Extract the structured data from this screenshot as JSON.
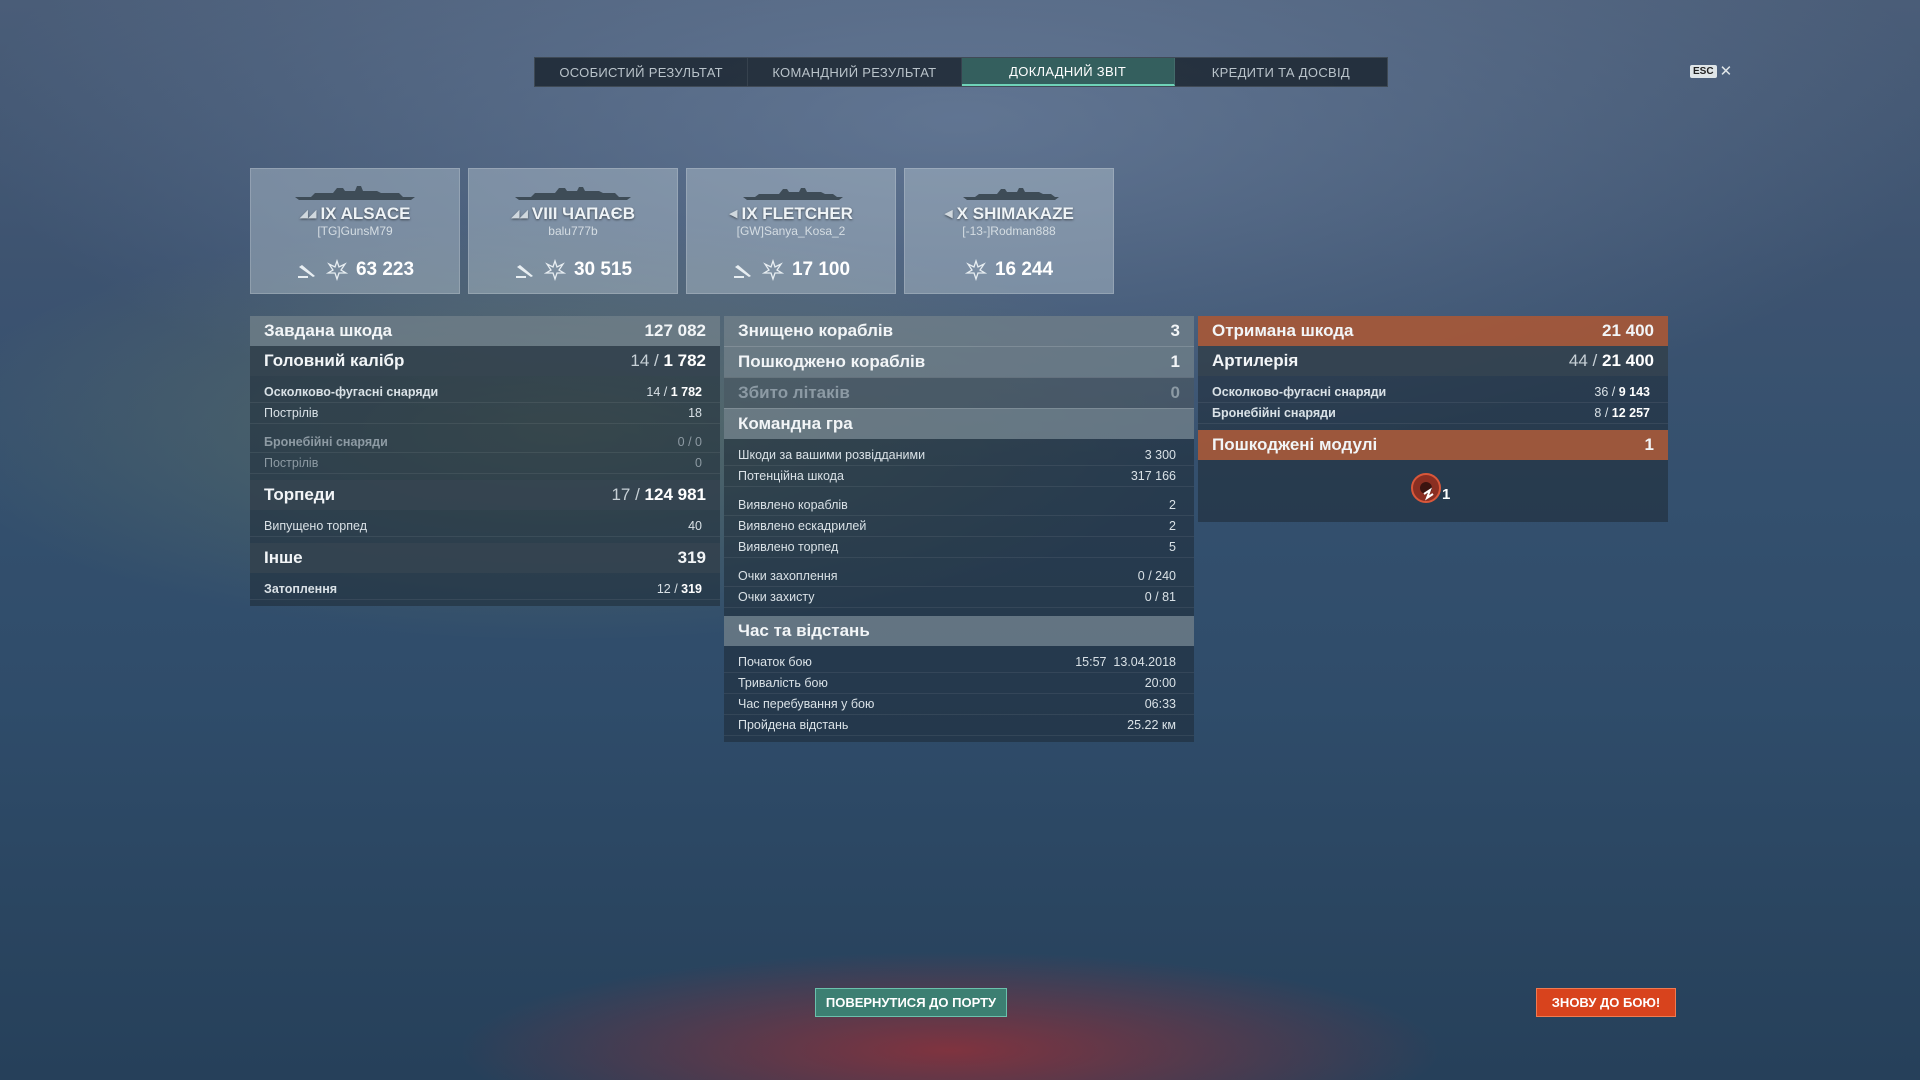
{
  "tabs": [
    "ОСОБИСТИЙ РЕЗУЛЬТАТ",
    "КОМАНДНИЙ РЕЗУЛЬТАТ",
    "ДОКЛАДНИЙ ЗВІТ",
    "КРЕДИТИ ТА ДОСВІД"
  ],
  "active_tab": "ДОКЛАДНИЙ ЗВІТ",
  "esc": {
    "key": "ESC",
    "close": "✕"
  },
  "ships": [
    {
      "tier_name": "IX ALSACE",
      "player": "[TG]GunsM79",
      "damage": "63 223"
    },
    {
      "tier_name": "VIII ЧАПАЄВ",
      "player": "balu777b",
      "damage": "30 515"
    },
    {
      "tier_name": "IX FLETCHER",
      "player": "[GW]Sanya_Kosa_2",
      "damage": "17 100"
    },
    {
      "tier_name": "X SHIMAKAZE",
      "player": "[-13-]Rodman888",
      "damage": "16 244"
    }
  ],
  "damage_dealt": {
    "title": "Завдана шкода",
    "total": "127 082",
    "main_battery": {
      "title": "Головний калібр",
      "hits": "14",
      "value": "1 782"
    },
    "he_label": "Осколково-фугасні снаряди",
    "he_hits": "14",
    "he_value": "1 782",
    "he_shots_label": "Пострілів",
    "he_shots": "18",
    "ap_label": "Бронебійні снаряди",
    "ap_value": "0 / 0",
    "ap_shots_label": "Пострілів",
    "ap_shots": "0",
    "torpedoes": {
      "title": "Торпеди",
      "hits": "17",
      "value": "124 981"
    },
    "torp_launched_label": "Випущено торпед",
    "torp_launched": "40",
    "other": {
      "title": "Інше",
      "value": "319"
    },
    "flooding_label": "Затоплення",
    "flooding_hits": "12",
    "flooding_value": "319"
  },
  "middle": {
    "destroyed_label": "Знищено кораблів",
    "destroyed": "3",
    "damaged_label": "Пошкоджено кораблів",
    "damaged": "1",
    "planes_label": "Збито літаків",
    "planes": "0",
    "team_title": "Командна гра",
    "team_rows": [
      {
        "label": "Шкоди за вашими розвідданими",
        "value": "3 300"
      },
      {
        "label": "Потенційна шкода",
        "value": "317 166"
      },
      {
        "label": "Виявлено кораблів",
        "value": "2"
      },
      {
        "label": "Виявлено ескадрилей",
        "value": "2"
      },
      {
        "label": "Виявлено торпед",
        "value": "5"
      },
      {
        "label": "Очки захоплення",
        "value": "0 / 240"
      },
      {
        "label": "Очки захисту",
        "value": "0 / 81"
      }
    ],
    "time_title": "Час та відстань",
    "time_rows": [
      {
        "label": "Початок бою",
        "value": "15:57  13.04.2018"
      },
      {
        "label": "Тривалість бою",
        "value": "20:00"
      },
      {
        "label": "Час перебування у бою",
        "value": "06:33"
      },
      {
        "label": "Пройдена відстань",
        "value": "25.22 км"
      }
    ]
  },
  "received": {
    "title": "Отримана шкода",
    "total": "21 400",
    "artillery_label": "Артилерія",
    "artillery_hits": "44",
    "artillery_value": "21 400",
    "he_label": "Осколково-фугасні снаряди",
    "he_hits": "36",
    "he_value": "9 143",
    "ap_label": "Бронебійні снаряди",
    "ap_hits": "8",
    "ap_value": "12 257",
    "modules_title": "Пошкоджені модулі",
    "modules_count": "1",
    "module_icon_count": "1"
  },
  "buttons": {
    "back_to_port": "ПОВЕРНУТИСЯ ДО ПОРТУ",
    "battle_again": "ЗНОВУ ДО БОЮ!"
  },
  "colors": {
    "accent_teal": "#3c7f72",
    "accent_orange": "#d8431d",
    "received_header": "#be5f37"
  },
  "icons": [
    "ship-silhouette-icon",
    "torpedo-icon",
    "damage-burst-icon",
    "class-battleship-icon",
    "class-cruiser-icon",
    "class-destroyer-icon",
    "engine-module-icon"
  ]
}
